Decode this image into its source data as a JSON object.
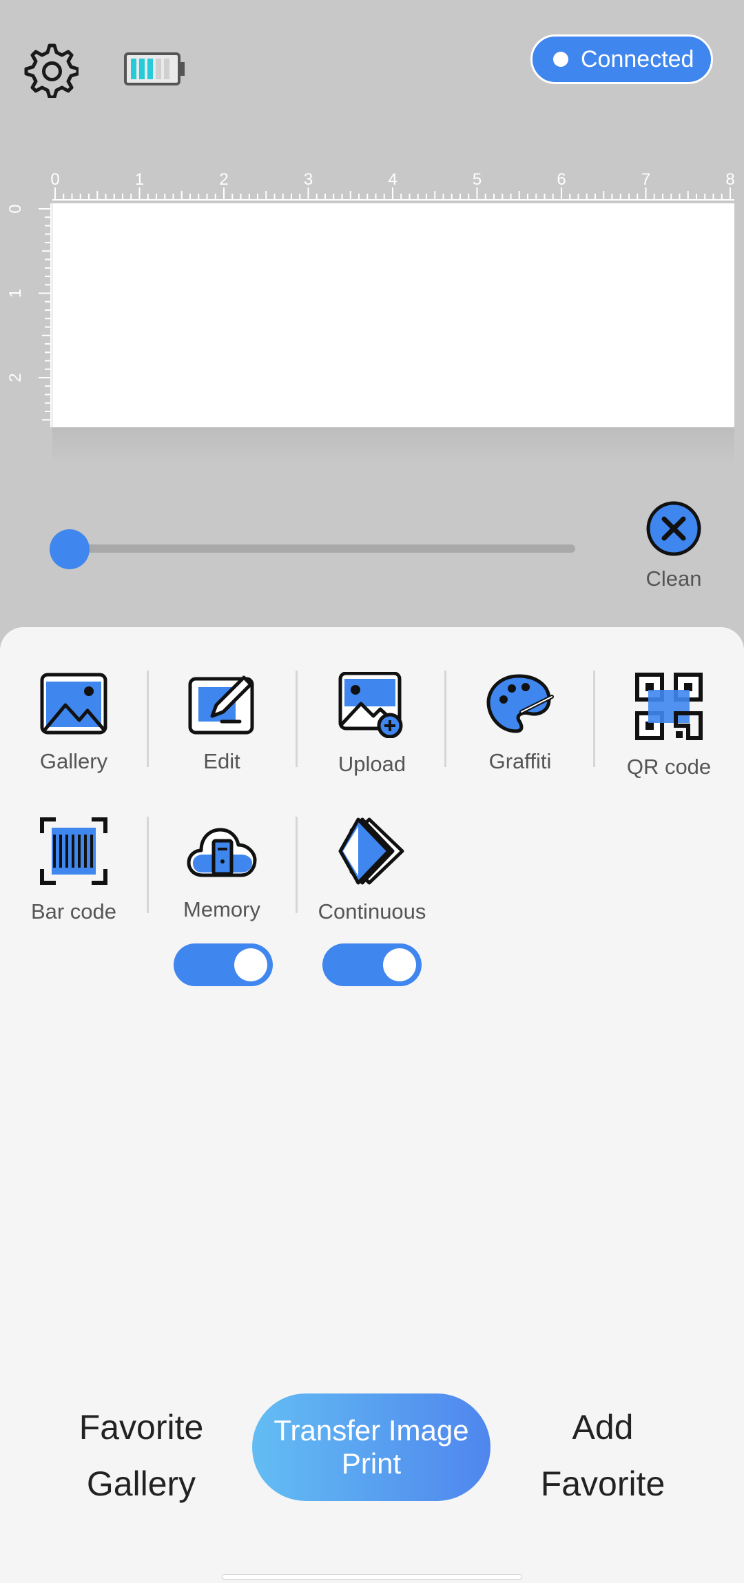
{
  "header": {
    "status_label": "Connected",
    "battery_level": 0.6
  },
  "ruler": {
    "horizontal_ticks": [
      "0",
      "1",
      "2",
      "3",
      "4",
      "5",
      "6",
      "7",
      "8"
    ],
    "vertical_ticks": [
      "0",
      "1",
      "2"
    ]
  },
  "slider": {
    "value": 0
  },
  "clean": {
    "label": "Clean"
  },
  "tools": {
    "gallery": "Gallery",
    "edit": "Edit",
    "upload": "Upload",
    "graffiti": "Graffiti",
    "qr_code": "QR code",
    "bar_code": "Bar code",
    "memory": "Memory",
    "continuous": "Continuous"
  },
  "toggles": {
    "memory_on": true,
    "continuous_on": true
  },
  "bottom": {
    "favorite_gallery_line1": "Favorite",
    "favorite_gallery_line2": "Gallery",
    "transfer_line1": "Transfer Image",
    "transfer_line2": "Print",
    "add_favorite_line1": "Add",
    "add_favorite_line2": "Favorite"
  },
  "colors": {
    "accent": "#3f86ee",
    "panel": "#f5f5f5",
    "background": "#c8c8c8"
  }
}
